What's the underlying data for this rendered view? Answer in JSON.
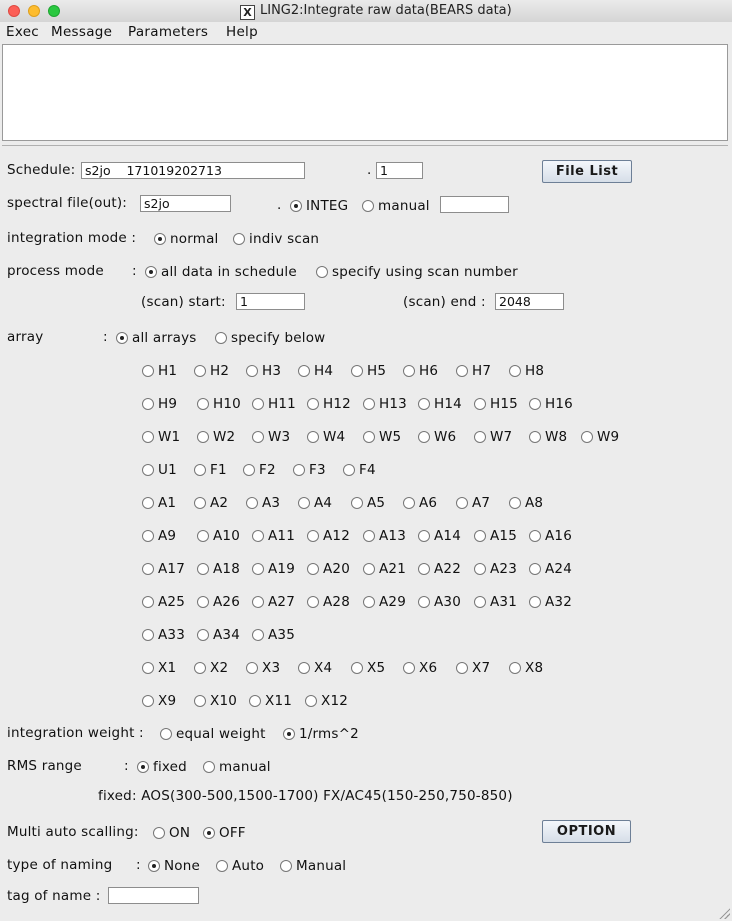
{
  "window": {
    "title": "LING2:Integrate raw data(BEARS data)",
    "x_logo": "X"
  },
  "menu": [
    "Exec",
    "Message",
    "Parameters",
    "Help"
  ],
  "form": {
    "schedule_label": "Schedule:",
    "schedule_value": "s2jo    171019202713",
    "schedule_dot": ".",
    "schedule_num": "1",
    "file_list_button": "File List",
    "spectral_label": "spectral file(out):",
    "spectral_value": "s2jo",
    "spectral_dot": ".",
    "integ_label": "INTEG",
    "manual_label": "manual",
    "manual_value": "",
    "integration_mode_label": "integration mode  :",
    "normal_label": "normal",
    "indiv_scan_label": "indiv scan",
    "process_mode_label": "process mode",
    "process_colon": ":",
    "all_data_label": "all data in schedule",
    "specify_scan_label": "specify using scan number",
    "scan_start_label": "(scan) start:",
    "scan_start_value": "1",
    "scan_end_label": "(scan) end  :",
    "scan_end_value": "2048",
    "array_label": "array",
    "array_colon": ":",
    "all_arrays_label": "all arrays",
    "specify_below_label": "specify below",
    "array_rows": [
      [
        "H1",
        "H2",
        "H3",
        "H4",
        "H5",
        "H6",
        "H7",
        "H8"
      ],
      [
        "H9",
        "H10",
        "H11",
        "H12",
        "H13",
        "H14",
        "H15",
        "H16"
      ],
      [
        "W1",
        "W2",
        "W3",
        "W4",
        "W5",
        "W6",
        "W7",
        "W8",
        "W9"
      ],
      [
        "U1",
        "F1",
        "F2",
        "F3",
        "F4"
      ],
      [
        "A1",
        "A2",
        "A3",
        "A4",
        "A5",
        "A6",
        "A7",
        "A8"
      ],
      [
        "A9",
        "A10",
        "A11",
        "A12",
        "A13",
        "A14",
        "A15",
        "A16"
      ],
      [
        "A17",
        "A18",
        "A19",
        "A20",
        "A21",
        "A22",
        "A23",
        "A24"
      ],
      [
        "A25",
        "A26",
        "A27",
        "A28",
        "A29",
        "A30",
        "A31",
        "A32"
      ],
      [
        "A33",
        "A34",
        "A35"
      ],
      [
        "X1",
        "X2",
        "X3",
        "X4",
        "X5",
        "X6",
        "X7",
        "X8"
      ],
      [
        "X9",
        "X10",
        "X11",
        "X12"
      ]
    ],
    "integration_weight_label": "integration weight :",
    "equal_weight_label": "equal weight",
    "rms_weight_label": "1/rms^2",
    "rms_range_label": "RMS range",
    "rms_colon": ":",
    "fixed_label": "fixed",
    "rms_manual_label": "manual",
    "fixed_note": "fixed: AOS(300-500,1500-1700) FX/AC45(150-250,750-850)",
    "multi_auto_label": "Multi auto scalling:",
    "on_label": "ON",
    "off_label": "OFF",
    "option_button": "OPTION",
    "naming_label": "type of naming",
    "naming_colon": ":",
    "none_label": "None",
    "auto_label": "Auto",
    "naming_manual_label": "Manual",
    "tag_label": "tag of name :",
    "tag_value": ""
  }
}
